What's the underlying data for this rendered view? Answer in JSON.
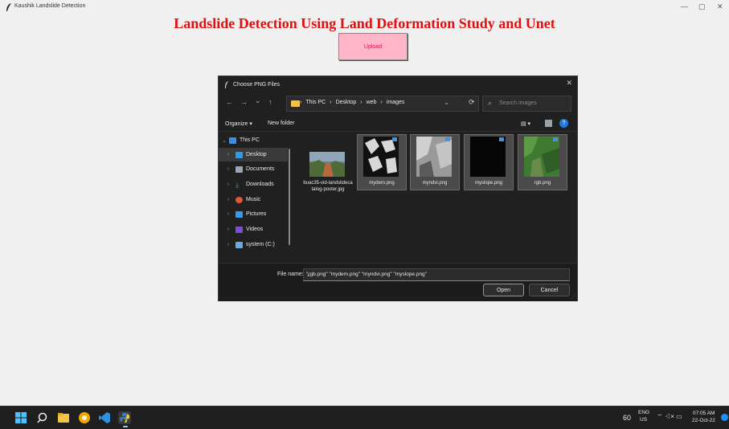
{
  "app": {
    "title": "Kaushik Landslide Detection",
    "minimize": "—",
    "maximize": "▢",
    "close": "✕"
  },
  "main": {
    "heading": "Landslide Detection Using Land Deformation Study and Unet",
    "upload_label": "Upload"
  },
  "dialog": {
    "title": "Choose PNG Files",
    "close": "✕",
    "nav": {
      "back": "←",
      "forward": "→",
      "recent": "⌄",
      "up": "↑",
      "refresh": "⟳"
    },
    "breadcrumbs": [
      "This PC",
      "›",
      "Desktop",
      "›",
      "web",
      "›",
      "images"
    ],
    "breadcrumb_lead": "›",
    "addr_dropdown": "⌄",
    "search_placeholder": "Search images",
    "toolbar": {
      "organize": "Organize ▾",
      "new_folder": "New folder",
      "view": "▤ ▾",
      "help": "?"
    },
    "tree": [
      {
        "label": "This PC",
        "color": "#3a8ee6"
      },
      {
        "label": "Desktop",
        "color": "#2b9cf2"
      },
      {
        "label": "Documents",
        "color": "#9aa4b2"
      },
      {
        "label": "Downloads",
        "color": "#3ab36b"
      },
      {
        "label": "Music",
        "color": "#e0573a"
      },
      {
        "label": "Pictures",
        "color": "#3a9be6"
      },
      {
        "label": "Videos",
        "color": "#7a4fd6"
      },
      {
        "label": "system (C:)",
        "color": "#6fa8dc"
      }
    ],
    "files": [
      {
        "name": "buac35-vid-landslidecatalog-poster.jpg"
      },
      {
        "name": "mydem.png"
      },
      {
        "name": "myndvi.png"
      },
      {
        "name": "myslope.png"
      },
      {
        "name": "rgb.png"
      }
    ],
    "filename_label": "File name:",
    "filename_value": "\"rgb.png\" \"mydem.png\" \"myndvi.png\" \"myslope.png\"",
    "open": "Open",
    "cancel": "Cancel"
  },
  "taskbar": {
    "weather": "60",
    "lang_top": "ENG",
    "lang_bottom": "US",
    "tray_icons": "⌔ ◁× ▭",
    "time": "07:05 AM",
    "date": "22-Oct-22"
  }
}
